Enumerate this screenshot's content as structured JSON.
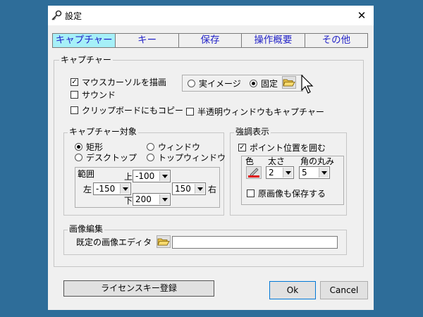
{
  "window": {
    "title": "設定",
    "close_glyph": "✕"
  },
  "tabs": [
    {
      "label": "キャプチャー",
      "active": true
    },
    {
      "label": "キー",
      "active": false
    },
    {
      "label": "保存",
      "active": false
    },
    {
      "label": "操作概要",
      "active": false
    },
    {
      "label": "その他",
      "active": false
    }
  ],
  "capture": {
    "group_title": "キャプチャー",
    "draw_cursor": {
      "label": "マウスカーソルを描画",
      "checked": true
    },
    "sound": {
      "label": "サウンド",
      "checked": false
    },
    "clipboard": {
      "label": "クリップボードにもコピー",
      "checked": false
    },
    "translucent": {
      "label": "半透明ウィンドウもキャプチャー",
      "checked": false
    },
    "mode_real": {
      "label": "実イメージ",
      "selected": false
    },
    "mode_fixed": {
      "label": "固定",
      "selected": true
    }
  },
  "target": {
    "group_title": "キャプチャー対象",
    "options": [
      {
        "label": "矩形",
        "selected": true
      },
      {
        "label": "ウィンドウ",
        "selected": false
      },
      {
        "label": "デスクトップ",
        "selected": false
      },
      {
        "label": "トップウィンドウ",
        "selected": false
      }
    ],
    "range": {
      "title": "範囲",
      "top_label": "上",
      "top_value": "-100",
      "left_label": "左",
      "left_value": "-150",
      "right_label": "右",
      "right_value": "150",
      "bottom_label": "下",
      "bottom_value": "200"
    }
  },
  "highlight": {
    "group_title": "強調表示",
    "surround": {
      "label": "ポイント位置を囲む",
      "checked": true
    },
    "color_label": "色",
    "thickness_label": "太さ",
    "thickness_value": "2",
    "radius_label": "角の丸み",
    "radius_value": "5",
    "save_original": {
      "label": "原画像も保存する",
      "checked": false
    },
    "pen_color": "#e01010"
  },
  "editor": {
    "group_title": "画像編集",
    "label": "既定の画像エディタ",
    "path_value": ""
  },
  "buttons": {
    "license": "ライセンスキー登録",
    "ok": "Ok",
    "cancel": "Cancel"
  },
  "check_glyph": "✓",
  "icons": [
    "wrench-key-icon",
    "close-icon",
    "folder-open-icon",
    "pen-color-icon",
    "mouse-pointer-icon"
  ]
}
